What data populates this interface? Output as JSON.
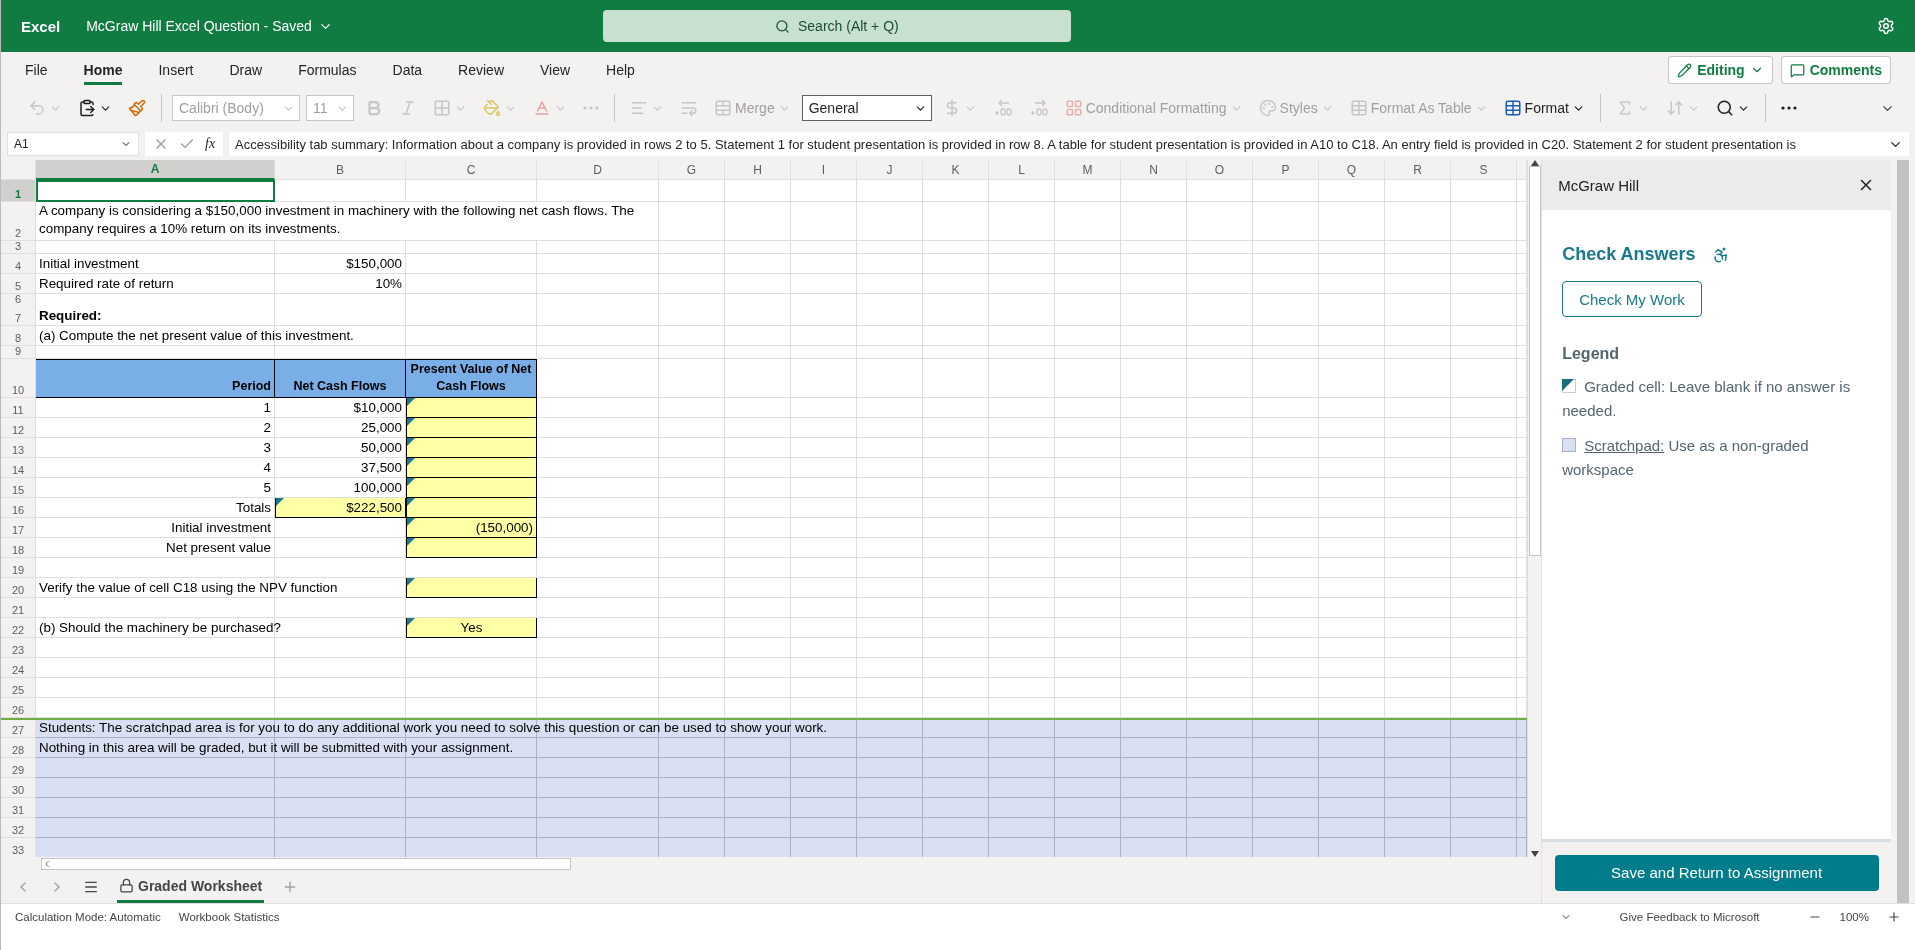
{
  "title_bar": {
    "app": "Excel",
    "document": "McGraw Hill Excel Question",
    "separator": "-",
    "status": "Saved",
    "search": {
      "placeholder": "Search (Alt + Q)"
    }
  },
  "menu": {
    "tabs": [
      {
        "label": "File",
        "selected": false
      },
      {
        "label": "Home",
        "selected": true
      },
      {
        "label": "Insert",
        "selected": false
      },
      {
        "label": "Draw",
        "selected": false
      },
      {
        "label": "Formulas",
        "selected": false
      },
      {
        "label": "Data",
        "selected": false
      },
      {
        "label": "Review",
        "selected": false
      },
      {
        "label": "View",
        "selected": false
      },
      {
        "label": "Help",
        "selected": false
      }
    ],
    "editing": "Editing",
    "comments": "Comments"
  },
  "ribbon": [
    {
      "kind": "undo",
      "disabled": true
    },
    {
      "kind": "paste",
      "disabled": false
    },
    {
      "kind": "painter",
      "disabled": false
    },
    {
      "kind": "sep"
    },
    {
      "kind": "font",
      "value": "Calibri (Body)",
      "disabled": true
    },
    {
      "kind": "size",
      "value": "11",
      "disabled": true
    },
    {
      "kind": "bold",
      "disabled": true
    },
    {
      "kind": "italic",
      "disabled": true
    },
    {
      "kind": "borders",
      "disabled": true
    },
    {
      "kind": "fill",
      "disabled": true
    },
    {
      "kind": "fontcolor",
      "disabled": true
    },
    {
      "kind": "more",
      "disabled": true
    },
    {
      "kind": "sep"
    },
    {
      "kind": "align",
      "disabled": true
    },
    {
      "kind": "wrap",
      "disabled": true
    },
    {
      "kind": "merge",
      "label": "Merge",
      "disabled": true
    },
    {
      "kind": "format_select",
      "value": "General",
      "disabled": false
    },
    {
      "kind": "currency",
      "disabled": true
    },
    {
      "kind": "dec_less",
      "disabled": true
    },
    {
      "kind": "dec_more",
      "disabled": true
    },
    {
      "kind": "conditional",
      "label": "Conditional Formatting",
      "disabled": true
    },
    {
      "kind": "styles",
      "label": "Styles",
      "disabled": true
    },
    {
      "kind": "table",
      "label": "Format As Table",
      "disabled": true
    },
    {
      "kind": "format",
      "label": "Format",
      "disabled": false
    },
    {
      "kind": "sep"
    },
    {
      "kind": "sum",
      "disabled": true
    },
    {
      "kind": "sort",
      "disabled": true
    },
    {
      "kind": "find",
      "disabled": false
    },
    {
      "kind": "sep"
    },
    {
      "kind": "more",
      "disabled": false
    }
  ],
  "formula_bar": {
    "name_box": "A1",
    "function_label": "fx",
    "formula": "Accessibility tab summary: Information about a company is provided in rows 2 to 5. Statement 1 for student presentation is provided in row 8. A table for student presentation is provided in A10 to C18. An entry field is provided in C20. Statement 2 for student presentation is"
  },
  "sheet": {
    "columns": [
      {
        "label": "A",
        "selected": true
      },
      {
        "label": "B",
        "selected": false
      },
      {
        "label": "C",
        "selected": false
      },
      {
        "label": "D",
        "selected": false
      },
      {
        "label": "G",
        "selected": false
      },
      {
        "label": "H",
        "selected": false
      },
      {
        "label": "I",
        "selected": false
      },
      {
        "label": "J",
        "selected": false
      },
      {
        "label": "K",
        "selected": false
      },
      {
        "label": "L",
        "selected": false
      },
      {
        "label": "M",
        "selected": false
      },
      {
        "label": "N",
        "selected": false
      },
      {
        "label": "O",
        "selected": false
      },
      {
        "label": "P",
        "selected": false
      },
      {
        "label": "Q",
        "selected": false
      },
      {
        "label": "R",
        "selected": false
      },
      {
        "label": "S",
        "selected": false
      }
    ],
    "rows": [
      {
        "number": "1",
        "selected": true,
        "scratchpad": false
      },
      {
        "number": "2",
        "selected": false,
        "scratchpad": false,
        "cells": [
          {
            "kind": "wrap",
            "text": "A company is considering a $150,000 investment in machinery with the following net cash flows. The company requires a 10% return on its investments."
          }
        ]
      },
      {
        "number": "3",
        "selected": false,
        "scratchpad": false
      },
      {
        "number": "4",
        "selected": false,
        "scratchpad": false,
        "cells": [
          {
            "kind": "text",
            "text": "Initial investment"
          },
          {
            "kind": "num",
            "text": "$150,000"
          }
        ]
      },
      {
        "number": "5",
        "selected": false,
        "scratchpad": false,
        "cells": [
          {
            "kind": "text",
            "text": "Required rate of return"
          },
          {
            "kind": "num",
            "text": "10%"
          }
        ]
      },
      {
        "number": "6",
        "selected": false,
        "scratchpad": false
      },
      {
        "number": "7",
        "selected": false,
        "scratchpad": false,
        "cells": [
          {
            "kind": "bold",
            "text": "Required:"
          }
        ]
      },
      {
        "number": "8",
        "selected": false,
        "scratchpad": false,
        "cells": [
          {
            "kind": "text",
            "text": "(a) Compute the net present value of this investment."
          }
        ]
      },
      {
        "number": "9",
        "selected": false,
        "scratchpad": false
      },
      {
        "number": "10",
        "selected": false,
        "scratchpad": false,
        "cells": [
          {
            "kind": "head_right",
            "text": "Period"
          },
          {
            "kind": "head",
            "text": "Net Cash Flows"
          },
          {
            "kind": "head",
            "text": "Present Value of Net Cash Flows"
          }
        ]
      },
      {
        "number": "11",
        "selected": false,
        "scratchpad": false,
        "cells": [
          {
            "kind": "num",
            "text": "1"
          },
          {
            "kind": "num",
            "text": "$10,000"
          },
          {
            "kind": "graded"
          }
        ]
      },
      {
        "number": "12",
        "selected": false,
        "scratchpad": false,
        "cells": [
          {
            "kind": "num",
            "text": "2"
          },
          {
            "kind": "num",
            "text": "25,000"
          },
          {
            "kind": "graded"
          }
        ]
      },
      {
        "number": "13",
        "selected": false,
        "scratchpad": false,
        "cells": [
          {
            "kind": "num",
            "text": "3"
          },
          {
            "kind": "num",
            "text": "50,000"
          },
          {
            "kind": "graded"
          }
        ]
      },
      {
        "number": "14",
        "selected": false,
        "scratchpad": false,
        "cells": [
          {
            "kind": "num",
            "text": "4"
          },
          {
            "kind": "num",
            "text": "37,500"
          },
          {
            "kind": "graded"
          }
        ]
      },
      {
        "number": "15",
        "selected": false,
        "scratchpad": false,
        "cells": [
          {
            "kind": "num",
            "text": "5"
          },
          {
            "kind": "num",
            "text": "100,000"
          },
          {
            "kind": "graded"
          }
        ]
      },
      {
        "number": "16",
        "selected": false,
        "scratchpad": false,
        "cells": [
          {
            "kind": "num",
            "text": "Totals"
          },
          {
            "kind": "graded",
            "text": "$222,500"
          },
          {
            "kind": "graded"
          }
        ]
      },
      {
        "number": "17",
        "selected": false,
        "scratchpad": false,
        "cells": [
          {
            "kind": "num",
            "text": "Initial investment"
          },
          null,
          {
            "kind": "graded",
            "text": "(150,000)"
          }
        ]
      },
      {
        "number": "18",
        "selected": false,
        "scratchpad": false,
        "cells": [
          {
            "kind": "num",
            "text": "Net present value"
          },
          null,
          {
            "kind": "graded"
          }
        ]
      },
      {
        "number": "19",
        "selected": false,
        "scratchpad": false
      },
      {
        "number": "20",
        "selected": false,
        "scratchpad": false,
        "cells": [
          {
            "kind": "text",
            "text": "Verify the value of cell C18 using the NPV function"
          },
          null,
          {
            "kind": "graded"
          }
        ]
      },
      {
        "number": "21",
        "selected": false,
        "scratchpad": false
      },
      {
        "number": "22",
        "selected": false,
        "scratchpad": false,
        "cells": [
          {
            "kind": "text",
            "text": "(b)  Should the machinery be purchased?"
          },
          null,
          {
            "kind": "graded_choice",
            "text": "Yes"
          }
        ]
      },
      {
        "number": "23",
        "selected": false,
        "scratchpad": false
      },
      {
        "number": "24",
        "selected": false,
        "scratchpad": false
      },
      {
        "number": "25",
        "selected": false,
        "scratchpad": false
      },
      {
        "number": "26",
        "selected": false,
        "scratchpad": false
      },
      {
        "number": "27",
        "selected": false,
        "scratchpad": true,
        "cells": [
          {
            "kind": "text",
            "text": "Students: The scratchpad area is for you to do any additional work you need to solve this question or can be used to show your work."
          }
        ]
      },
      {
        "number": "28",
        "selected": false,
        "scratchpad": true,
        "cells": [
          {
            "kind": "text",
            "text": "Nothing in this area will be graded, but it will be submitted with your assignment."
          }
        ]
      },
      {
        "number": "29",
        "selected": false,
        "scratchpad": true
      },
      {
        "number": "30",
        "selected": false,
        "scratchpad": true
      },
      {
        "number": "31",
        "selected": false,
        "scratchpad": true
      },
      {
        "number": "32",
        "selected": false,
        "scratchpad": true
      },
      {
        "number": "33",
        "selected": false,
        "scratchpad": true
      }
    ]
  },
  "sheet_tabs": [
    {
      "label": "Graded Worksheet",
      "selected": true,
      "locked": true
    }
  ],
  "status_bar": {
    "left": [
      "Calculation Mode: Automatic",
      "Workbook Statistics"
    ],
    "feedback": "Give Feedback to Microsoft",
    "zoom": "100%"
  },
  "panel": {
    "title": "McGraw Hill",
    "heading": "Check Answers",
    "check_button": "Check My Work",
    "legend_title": "Legend",
    "legend": [
      {
        "kind": "graded",
        "text": "Graded cell: Leave blank if no answer is needed."
      },
      {
        "kind": "scratchpad",
        "link": "Scratchpad:",
        "text": "Use as a non-graded workspace"
      }
    ],
    "save_button": "Save and Return to Assignment"
  }
}
